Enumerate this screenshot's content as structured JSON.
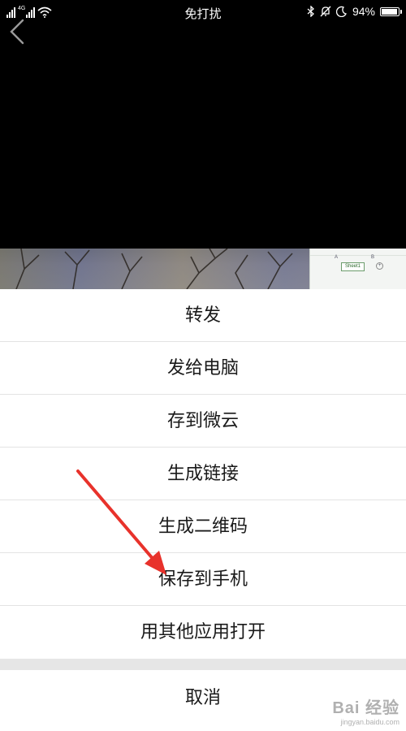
{
  "status_bar": {
    "network_label": "4G",
    "title": "免打扰",
    "battery_text": "94%",
    "battery_level": 0.94
  },
  "excel_preview": {
    "col_a": "A",
    "col_b": "B",
    "sheet_tab": "Sheet1",
    "add_symbol": "+"
  },
  "menu": {
    "items": [
      {
        "label": "转发"
      },
      {
        "label": "发给电脑"
      },
      {
        "label": "存到微云"
      },
      {
        "label": "生成链接"
      },
      {
        "label": "生成二维码"
      },
      {
        "label": "保存到手机"
      },
      {
        "label": "用其他应用打开"
      }
    ],
    "cancel_label": "取消"
  },
  "annotation": {
    "arrow_color": "#e8322b"
  },
  "watermark": {
    "brand": "Bai 经验",
    "url": "jingyan.baidu.com"
  }
}
